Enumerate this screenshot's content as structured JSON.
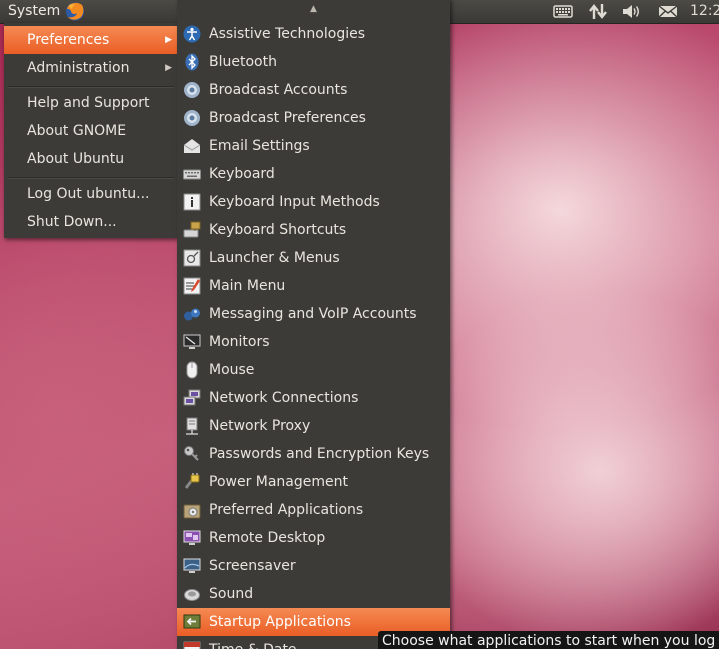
{
  "panel": {
    "system_label": "System",
    "clock": "12:2",
    "tray_icons": [
      "keyboard-icon",
      "network-arrows-icon",
      "volume-icon",
      "mail-icon"
    ]
  },
  "system_menu": {
    "items": [
      {
        "label": "Preferences",
        "submenu": true,
        "active": true
      },
      {
        "label": "Administration",
        "submenu": true
      },
      {
        "label": "Help and Support"
      },
      {
        "label": "About GNOME"
      },
      {
        "label": "About Ubuntu"
      },
      {
        "label": "Log Out ubuntu..."
      },
      {
        "label": "Shut Down..."
      }
    ]
  },
  "preferences_menu": {
    "scroll_up_icon": "scroll-up-arrow-icon",
    "items": [
      {
        "label": "Assistive Technologies",
        "icon": "accessibility-icon"
      },
      {
        "label": "Bluetooth",
        "icon": "bluetooth-icon"
      },
      {
        "label": "Broadcast Accounts",
        "icon": "broadcast-accounts-icon"
      },
      {
        "label": "Broadcast Preferences",
        "icon": "broadcast-preferences-icon"
      },
      {
        "label": "Email Settings",
        "icon": "email-icon"
      },
      {
        "label": "Keyboard",
        "icon": "keyboard-icon"
      },
      {
        "label": "Keyboard Input Methods",
        "icon": "info-icon"
      },
      {
        "label": "Keyboard Shortcuts",
        "icon": "keyboard-shortcuts-icon"
      },
      {
        "label": "Launcher & Menus",
        "icon": "launcher-icon"
      },
      {
        "label": "Main Menu",
        "icon": "main-menu-icon"
      },
      {
        "label": "Messaging and VoIP Accounts",
        "icon": "messaging-icon"
      },
      {
        "label": "Monitors",
        "icon": "monitor-icon"
      },
      {
        "label": "Mouse",
        "icon": "mouse-icon"
      },
      {
        "label": "Network Connections",
        "icon": "network-icon"
      },
      {
        "label": "Network Proxy",
        "icon": "network-proxy-icon"
      },
      {
        "label": "Passwords and Encryption Keys",
        "icon": "key-icon"
      },
      {
        "label": "Power Management",
        "icon": "power-icon"
      },
      {
        "label": "Preferred Applications",
        "icon": "preferred-apps-icon"
      },
      {
        "label": "Remote Desktop",
        "icon": "remote-desktop-icon"
      },
      {
        "label": "Screensaver",
        "icon": "screensaver-icon"
      },
      {
        "label": "Sound",
        "icon": "sound-icon"
      },
      {
        "label": "Startup Applications",
        "icon": "startup-icon",
        "active": true
      },
      {
        "label": "Time & Date",
        "icon": "calendar-icon"
      }
    ]
  },
  "tooltip": {
    "text": "Choose what applications to start when you log in"
  },
  "colors": {
    "accent": "#e95e25",
    "menu_bg": "#3c3b37",
    "panel_bg": "#3a3935"
  }
}
